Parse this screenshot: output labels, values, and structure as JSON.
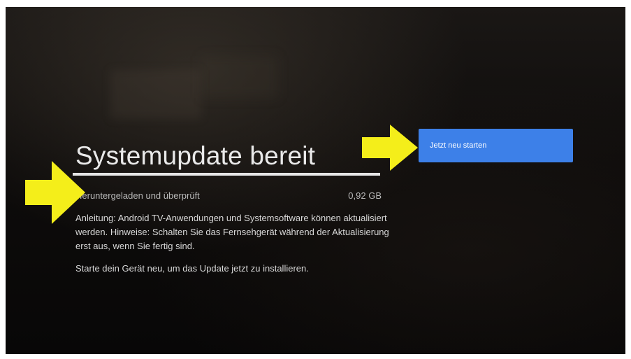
{
  "screen": {
    "title": "Systemupdate bereit",
    "status": "Heruntergeladen und überprüft",
    "size": "0,92 GB",
    "progress": 1.0,
    "description": "Anleitung: Android TV-Anwendungen und Systemsoftware können aktualisiert werden. Hinweise: Schalten Sie das Fernsehgerät während der Aktualisierung erst aus, wenn Sie fertig sind.",
    "hint": "Starte dein Gerät neu, um das Update jetzt zu installieren."
  },
  "actions": {
    "restart_label": "Jetzt neu starten"
  },
  "colors": {
    "button": "#3d80e8",
    "arrow": "#f4ee1a"
  },
  "icons": {
    "left_arrow": "arrow-right-icon",
    "right_arrow": "arrow-right-icon"
  }
}
